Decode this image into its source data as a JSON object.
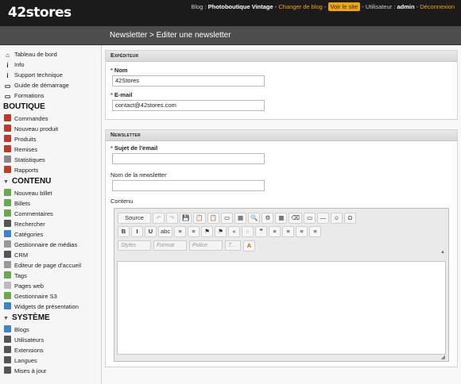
{
  "topbar": {
    "logo": "42stores",
    "blog_label": "Blog :",
    "blog_name": "Photoboutique Vintage",
    "sep": "-",
    "change_blog": "Changer de blog",
    "view_site": "Voir le site",
    "user_label": "Utilisateur :",
    "user_name": "admin",
    "logout": "Déconnexion"
  },
  "header": {
    "title": "Newsletter > Editer une newsletter"
  },
  "sidebar": {
    "top_items": [
      {
        "label": "Tableau de bord",
        "icon": "home-icon"
      },
      {
        "label": "Info",
        "icon": "info-icon"
      },
      {
        "label": "Support technique",
        "icon": "info-icon"
      },
      {
        "label": "Guide de démarrage",
        "icon": "book-icon"
      },
      {
        "label": "Formations",
        "icon": "book-icon"
      }
    ],
    "boutique": {
      "title": "BOUTIQUE",
      "items": [
        {
          "label": "Commandes",
          "color": "#c0392b"
        },
        {
          "label": "Nouveau produit",
          "color": "#c0392b"
        },
        {
          "label": "Produits",
          "color": "#c0392b"
        },
        {
          "label": "Remises",
          "color": "#c0392b"
        },
        {
          "label": "Statistiques",
          "color": "#888"
        },
        {
          "label": "Rapports",
          "color": "#c0392b"
        }
      ]
    },
    "contenu": {
      "title": "CONTENU",
      "items": [
        {
          "label": "Nouveau billet",
          "color": "#6aa84f"
        },
        {
          "label": "Billets",
          "color": "#6aa84f"
        },
        {
          "label": "Commentaires",
          "color": "#6aa84f"
        },
        {
          "label": "Rechercher",
          "color": "#555"
        },
        {
          "label": "Catégories",
          "color": "#3d85c6"
        },
        {
          "label": "Gestionnaire de médias",
          "color": "#999"
        },
        {
          "label": "CRM",
          "color": "#555"
        },
        {
          "label": "Editeur de page d'accueil",
          "color": "#999"
        },
        {
          "label": "Tags",
          "color": "#6aa84f"
        },
        {
          "label": "Pages web",
          "color": "#bbb"
        },
        {
          "label": "Gestionnaire S3",
          "color": "#6aa84f"
        },
        {
          "label": "Widgets de présentation",
          "color": "#3d85c6"
        }
      ]
    },
    "systeme": {
      "title": "SYSTÈME",
      "items": [
        {
          "label": "Blogs",
          "color": "#3d85c6"
        },
        {
          "label": "Utilisateurs",
          "color": "#555"
        },
        {
          "label": "Extensions",
          "color": "#555"
        },
        {
          "label": "Langues",
          "color": "#555"
        },
        {
          "label": "Mises à jour",
          "color": "#555"
        }
      ]
    }
  },
  "expediteur": {
    "title": "Expéditeur",
    "name_label": "Nom",
    "name_value": "42Stores",
    "email_label": "E-mail",
    "email_value": "contact@42stores.com",
    "required_mark": "*"
  },
  "newsletter": {
    "title": "Newsletter",
    "subject_label": "Sujet de l'email",
    "subject_value": "",
    "name_label": "Nom de la newsletter",
    "name_value": "",
    "content_label": "Contenu",
    "required_mark": "*"
  },
  "editor": {
    "source_label": "Source",
    "row1": [
      "↶",
      "↷",
      "💾",
      "📋",
      "📋",
      "▭",
      "▦",
      "🔍",
      "⚙",
      "▦",
      "⌫",
      "▭",
      "—",
      "☺",
      "Ω"
    ],
    "row2": [
      "B",
      "I",
      "U",
      "abc",
      "≡",
      "≡",
      "⚑",
      "⚑",
      "«",
      "»",
      "❞",
      "≡",
      "≡",
      "≡",
      "≡"
    ],
    "styles_placeholder": "Styles",
    "format_placeholder": "Format",
    "font_placeholder": "Police",
    "size_placeholder": "T...",
    "color_label": "A",
    "collapse": "▲",
    "resize": "◢"
  }
}
